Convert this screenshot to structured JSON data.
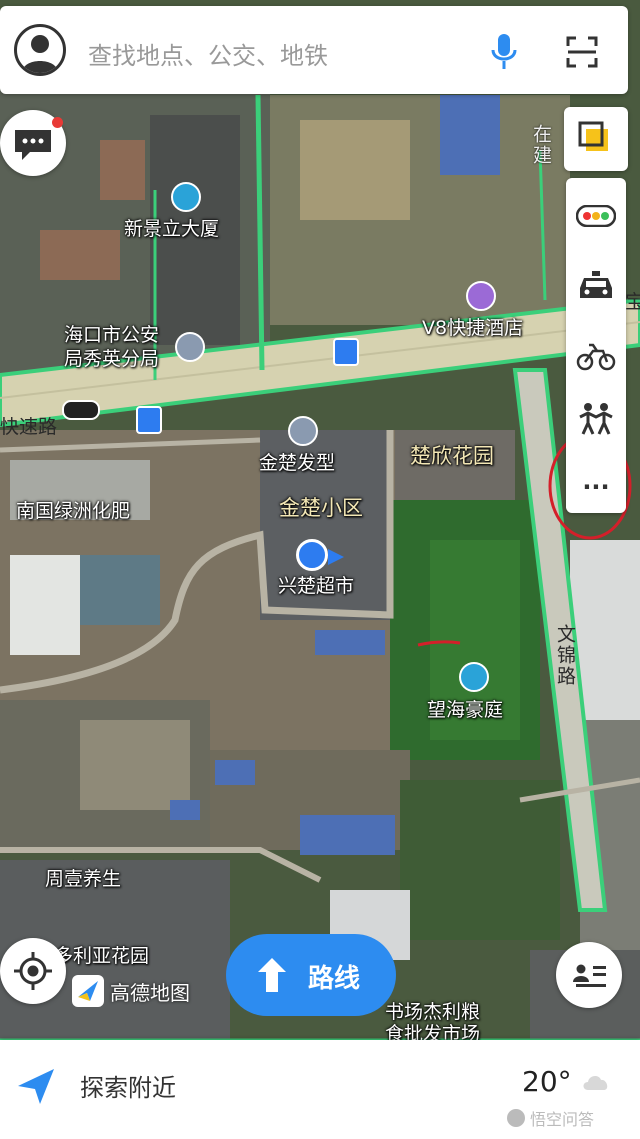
{
  "search": {
    "placeholder": "查找地点、公交、地铁",
    "avatar_icon": "user-avatar-icon",
    "mic_icon": "microphone-icon",
    "scan_icon": "scan-icon"
  },
  "map_labels": {
    "poi_xinjingli": "新景立大厦",
    "poi_police_1": "海口市公安",
    "poi_police_2": "局秀英分局",
    "poi_hotel": "V8快捷酒店",
    "poi_jinchu_salon": "金楚发型",
    "poi_chuxin_garden": "楚欣花园",
    "poi_jinchu_community": "金楚小区",
    "poi_xingchu_market": "兴楚超市",
    "poi_nanguo": "南国绿洲化肥",
    "poi_wanghai": "望海豪庭",
    "poi_zhouyi": "周壹养生",
    "poi_duoliya": "多利亚花园",
    "poi_market_1": "书场杰利粮",
    "poi_market_2": "食批发市场",
    "road_expressway": "快速路",
    "road_wenjin": "文锦路",
    "road_building": "在建",
    "road_bao": "宝",
    "watermark": "高德地图"
  },
  "side_tools": {
    "layers_icon": "layers-icon",
    "traffic_icon": "traffic-light-icon",
    "taxi_icon": "taxi-icon",
    "bike_icon": "bicycle-icon",
    "walk_icon": "walking-people-icon",
    "more_icon": "more-dots-icon",
    "more_label": "..."
  },
  "buttons": {
    "messages_icon": "chat-bubble-icon",
    "locate_icon": "locate-target-icon",
    "list_icon": "list-card-icon",
    "route_label": "路线",
    "route_icon": "route-arrow-icon"
  },
  "bottom_bar": {
    "explore_label": "探索附近",
    "temperature": "20°",
    "weather_icon": "cloud-icon",
    "nav_icon": "navigation-arrow-icon"
  },
  "overlay": {
    "watermark": "悟空问答"
  },
  "colors": {
    "road_outline": "#3bcf7a",
    "route_blue": "#2d8cf0",
    "annotation_red": "#d41f2a",
    "location_blue": "#2d7cf0"
  }
}
